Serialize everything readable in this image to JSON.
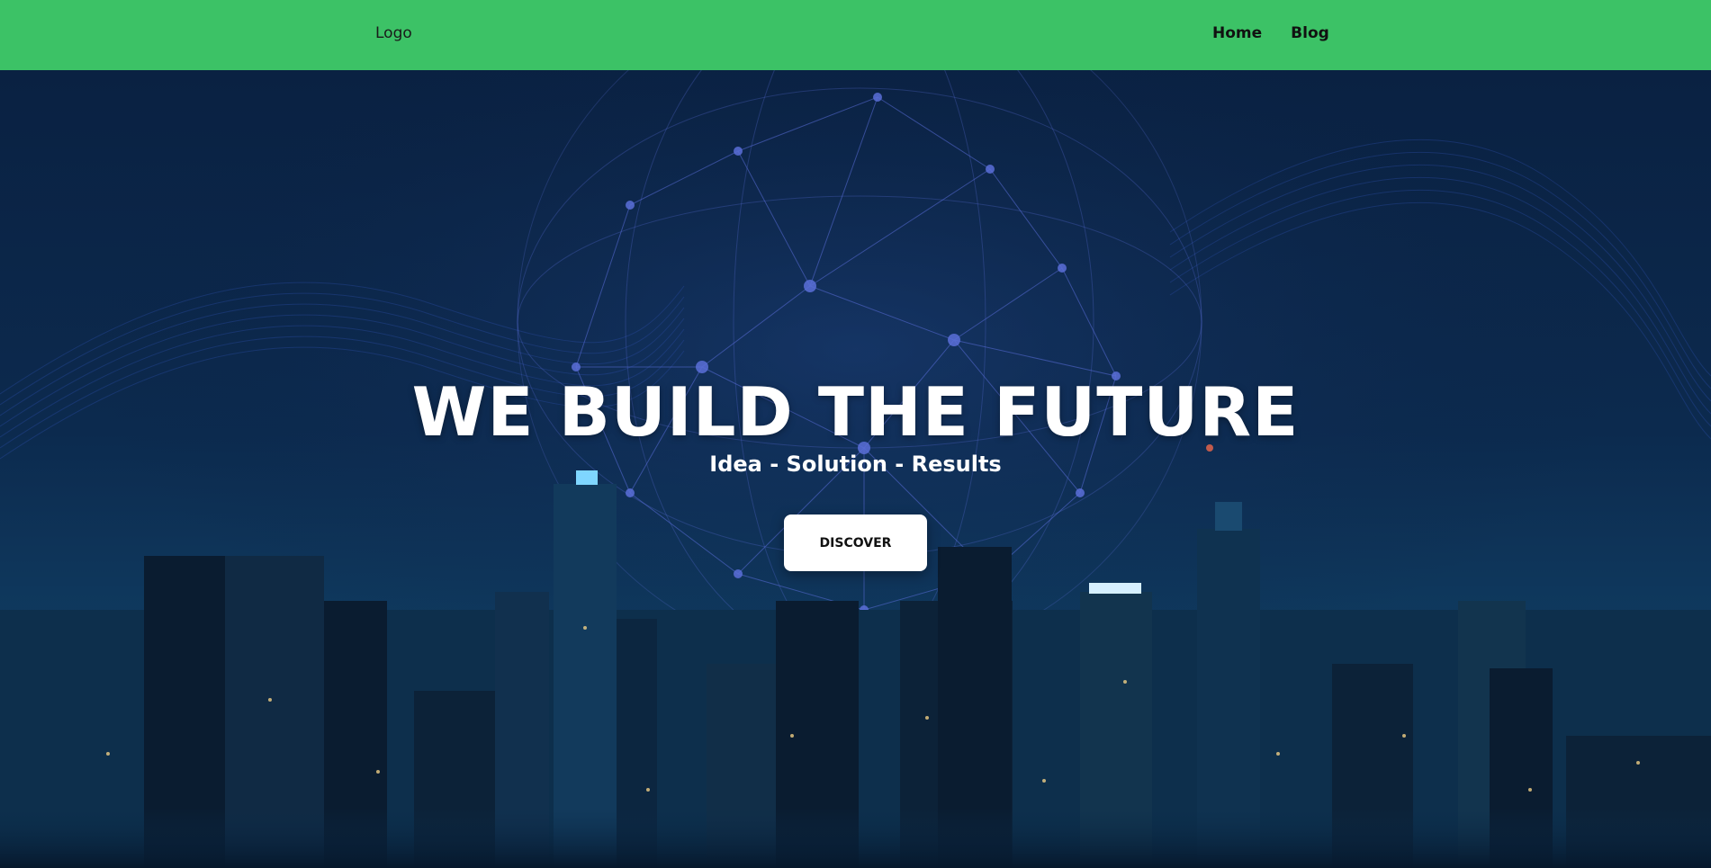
{
  "header": {
    "logo": "Logo",
    "nav": [
      "Home",
      "Blog"
    ]
  },
  "hero": {
    "title": "WE BUILD THE FUTURE",
    "subtitle": "Idea - Solution - Results",
    "cta_label": "DISCOVER",
    "background_image": "city-night-skyline-with-network-globe"
  },
  "colors": {
    "nav_background": "#3cc266",
    "hero_dark": "#0a2142",
    "network_lines": "#5a6ed8",
    "cta_background": "#ffffff"
  }
}
